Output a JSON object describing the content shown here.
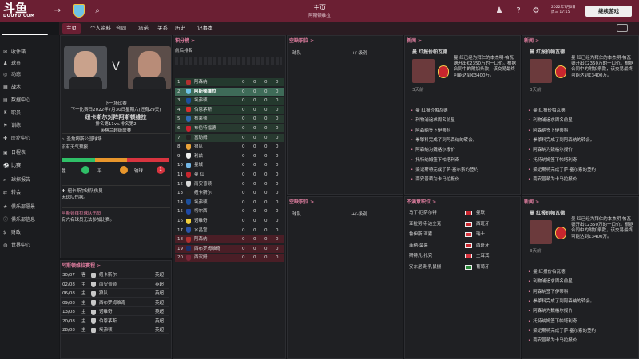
{
  "colors": {
    "brand": "#6b1f33",
    "accent": "#e07ea0",
    "green": "#2fbf67",
    "orange": "#e8962c",
    "red": "#d8343f"
  },
  "stream": {
    "logo": "斗鱼",
    "logo_sub": "DOUYU.COM",
    "room_id": "0336240"
  },
  "header": {
    "title": "主页",
    "subtitle": "阿斯顿维拉",
    "date_line1": "2022年7月6日",
    "date_line2": "周三 17:15",
    "continue_label": "继续游戏"
  },
  "tabs": [
    "主页",
    "个人资料",
    "合同",
    "承诺",
    "关系",
    "历史",
    "记事本"
  ],
  "sidebar": [
    {
      "label": "收件箱",
      "icon": "inbox-icon"
    },
    {
      "label": "球员",
      "icon": "players-icon"
    },
    {
      "label": "动态",
      "icon": "news-icon"
    },
    {
      "label": "战术",
      "icon": "tactics-icon"
    },
    {
      "label": "数据中心",
      "icon": "data-icon"
    },
    {
      "label": "职员",
      "icon": "staff-icon"
    },
    {
      "label": "训练",
      "icon": "training-icon"
    },
    {
      "label": "医疗中心",
      "icon": "medical-icon"
    },
    {
      "label": "日程表",
      "icon": "calendar-icon"
    },
    {
      "label": "比赛",
      "icon": "match-icon"
    },
    {
      "label": "球探报告",
      "icon": "scouting-icon"
    },
    {
      "label": "转会",
      "icon": "transfer-icon"
    },
    {
      "label": "俱乐部愿景",
      "icon": "vision-icon"
    },
    {
      "label": "俱乐部信息",
      "icon": "club-info-icon"
    },
    {
      "label": "财政",
      "icon": "finance-icon"
    },
    {
      "label": "世界中心",
      "icon": "world-icon"
    }
  ],
  "next_match": {
    "heading": "下一场比赛",
    "when": "下一比赛日2022年7月30日星期六(还有29天)",
    "teams": "纽卡斯尔对阵阿斯顿维拉",
    "positions": "排名第11vs.排名第2",
    "league": "英格兰超级联赛",
    "stadium": "圣詹姆斯公园球场",
    "weather": "没有天气预报",
    "form_labels": [
      "胜",
      "平",
      "输球"
    ],
    "form_values": [
      "",
      "",
      "1"
    ]
  },
  "injury": {
    "title": "纽卡斯尔球队伤员",
    "text": "无球队伤病。"
  },
  "ticket": {
    "title": "阿斯顿维拉球队伤员",
    "text": "有六名球员无法参加比赛。"
  },
  "fixtures": {
    "title": "阿斯顿维拉赛程 >",
    "rows": [
      {
        "date": "30/07",
        "venue": "客",
        "opp": "纽卡斯尔",
        "comp": "英超"
      },
      {
        "date": "02/08",
        "venue": "主",
        "opp": "南安普顿",
        "comp": "英超"
      },
      {
        "date": "06/08",
        "venue": "主",
        "opp": "狼队",
        "comp": "英超"
      },
      {
        "date": "09/08",
        "venue": "主",
        "opp": "西布罗姆维奇",
        "comp": "英超"
      },
      {
        "date": "13/08",
        "venue": "主",
        "opp": "诺维奇",
        "comp": "英超"
      },
      {
        "date": "20/08",
        "venue": "主",
        "opp": "伯恩茅斯",
        "comp": "英超"
      },
      {
        "date": "28/08",
        "venue": "主",
        "opp": "埃弗顿",
        "comp": "英超"
      }
    ]
  },
  "league_table": {
    "title": "积分榜 >",
    "subtitle": "英格兰超级联赛",
    "header_label": "前后排名",
    "rows": [
      {
        "pos": "1",
        "team": "阿森纳",
        "p": "0",
        "w": "0",
        "d": "0",
        "pts": "0",
        "zone": "cl"
      },
      {
        "pos": "2",
        "team": "阿斯顿维拉",
        "p": "0",
        "w": "0",
        "d": "0",
        "pts": "0",
        "zone": "cl",
        "me": true
      },
      {
        "pos": "3",
        "team": "埃弗顿",
        "p": "0",
        "w": "0",
        "d": "0",
        "pts": "0",
        "zone": "cl"
      },
      {
        "pos": "4",
        "team": "伯恩茅斯",
        "p": "0",
        "w": "0",
        "d": "0",
        "pts": "0",
        "zone": "cl"
      },
      {
        "pos": "5",
        "team": "布莱顿",
        "p": "0",
        "w": "0",
        "d": "0",
        "pts": "0",
        "zone": "el"
      },
      {
        "pos": "6",
        "team": "布伦特福德",
        "p": "0",
        "w": "0",
        "d": "0",
        "pts": "0",
        "zone": "el"
      },
      {
        "pos": "7",
        "team": "富勒姆",
        "p": "0",
        "w": "0",
        "d": "0",
        "pts": "0",
        "zone": "el"
      },
      {
        "pos": "8",
        "team": "狼队",
        "p": "0",
        "w": "0",
        "d": "0",
        "pts": "0",
        "zone": ""
      },
      {
        "pos": "9",
        "team": "利兹",
        "p": "0",
        "w": "0",
        "d": "0",
        "pts": "0",
        "zone": ""
      },
      {
        "pos": "10",
        "team": "曼城",
        "p": "0",
        "w": "0",
        "d": "0",
        "pts": "0",
        "zone": ""
      },
      {
        "pos": "11",
        "team": "曼 红",
        "p": "0",
        "w": "0",
        "d": "0",
        "pts": "0",
        "zone": ""
      },
      {
        "pos": "12",
        "team": "南安普顿",
        "p": "0",
        "w": "0",
        "d": "0",
        "pts": "0",
        "zone": ""
      },
      {
        "pos": "13",
        "team": "纽卡斯尔",
        "p": "0",
        "w": "0",
        "d": "0",
        "pts": "0",
        "zone": ""
      },
      {
        "pos": "14",
        "team": "埃弗顿",
        "p": "0",
        "w": "0",
        "d": "0",
        "pts": "0",
        "zone": ""
      },
      {
        "pos": "15",
        "team": "切尔西",
        "p": "0",
        "w": "0",
        "d": "0",
        "pts": "0",
        "zone": ""
      },
      {
        "pos": "16",
        "team": "诺维奇",
        "p": "0",
        "w": "0",
        "d": "0",
        "pts": "0",
        "zone": ""
      },
      {
        "pos": "17",
        "team": "水晶宫",
        "p": "0",
        "w": "0",
        "d": "0",
        "pts": "0",
        "zone": ""
      },
      {
        "pos": "18",
        "team": "阿森纳",
        "p": "0",
        "w": "0",
        "d": "0",
        "pts": "0",
        "zone": "rel"
      },
      {
        "pos": "19",
        "team": "西布罗姆维奇",
        "p": "0",
        "w": "0",
        "d": "0",
        "pts": "0",
        "zone": "rel"
      },
      {
        "pos": "20",
        "team": "西汉姆",
        "p": "0",
        "w": "0",
        "d": "0",
        "pts": "0",
        "zone": "rel"
      }
    ]
  },
  "transfer_top": {
    "title": "空缺职位 >",
    "col1": "球队",
    "col2": "+/-级别"
  },
  "transfer_mid": {
    "title": "空缺职位 >",
    "col1": "球队",
    "col2": "+/-级别"
  },
  "players_panel": {
    "title": "不满意职位 >",
    "rows": [
      {
        "name": "马丁·厄萨尔特",
        "club": "曼联"
      },
      {
        "name": "亚拉努特·达立克",
        "club": "西班牙"
      },
      {
        "name": "鲁伊斯·亚索",
        "club": "瑞士"
      },
      {
        "name": "菲纳·莫莱",
        "club": "西班牙"
      },
      {
        "name": "斯特凡·扎克",
        "club": "土耳其"
      },
      {
        "name": "安东尼奥·乳鼠摄",
        "club": "葡萄牙"
      }
    ]
  },
  "news1": {
    "title": "新闻 >",
    "headline": "曼 红报价帕瓦德",
    "body": "曼 红已经为拜仁的本杰明·帕瓦德开出€2350万的一口价。根据合同中的附加条款，该交易最终可能达到€3400万。",
    "date": "3天前",
    "items": [
      "曼 红报价帕瓦德",
      "利物浦追求周名前星",
      "阿森纳签下伊蒂科",
      "拳擎科完成了到阿森纳的转会。",
      "阿森纳为魏格尔报价",
      "托特纳姆签下帕塔利奇",
      "梁记斯特完成了萨·塞尔索的签约",
      "南安普顿为卡马拉报价"
    ]
  },
  "news2": {
    "title": "新闻 >",
    "headline": "曼 红报价帕瓦德",
    "body": "曼 红已经为拜仁的本杰明·帕瓦德开出€2350万的一口价。根据合同中的附加条款，该交易最终可能达到€3400万。",
    "date": "3天前",
    "items": [
      "曼 红报价帕瓦德",
      "利物浦追求周名前星",
      "阿森纳签下伊蒂科",
      "拳擎科完成了到阿森纳的转会。",
      "阿森纳为魏格尔报价",
      "托特纳姆签下帕塔利奇",
      "梁记斯特完成了萨·塞尔索的签约",
      "南安普顿为卡马拉报价"
    ]
  },
  "news3": {
    "title": "新闻 >",
    "headline": "曼 红报价帕瓦德",
    "body": "曼 红已经为拜仁的本杰明·帕瓦德开出€2350万的一口价。根据合同中的附加条款，该交易最终可能达到€3400万。",
    "date": "3天前",
    "items": [
      "曼 红报价帕瓦德",
      "利物浦追求周名前星",
      "阿森纳签下伊蒂科",
      "拳擎科完成了到阿森纳的转会。",
      "阿森纳为魏格尔报价",
      "托特纳姆签下帕塔利奇",
      "梁记斯特完成了萨·塞尔索的签约",
      "南安普顿为卡马拉报价"
    ]
  }
}
